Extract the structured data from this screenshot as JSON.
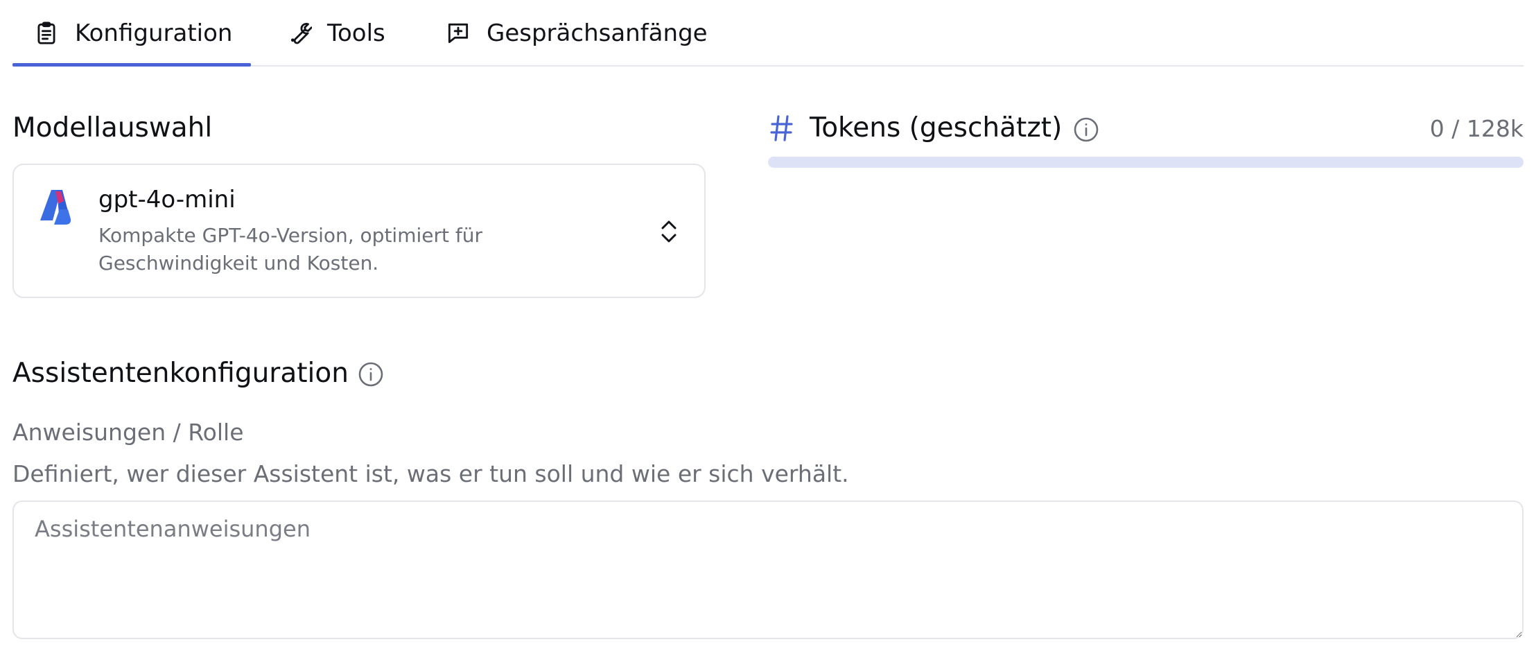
{
  "tabs": [
    {
      "label": "Konfiguration",
      "icon": "clipboard-icon",
      "active": true
    },
    {
      "label": "Tools",
      "icon": "wrench-icon",
      "active": false
    },
    {
      "label": "Gesprächsanfänge",
      "icon": "message-plus-icon",
      "active": false
    }
  ],
  "model_section": {
    "title": "Modellauswahl",
    "selected_model": {
      "name": "gpt-4o-mini",
      "description": "Kompakte GPT-4o-Version, optimiert für Geschwindigkeit und Kosten.",
      "icon": "azure-logo-icon"
    }
  },
  "tokens": {
    "title": "Tokens (geschätzt)",
    "count": "0 / 128k",
    "fill_fraction": 0,
    "icon": "hash-icon"
  },
  "assistant_config": {
    "title": "Assistentenkonfiguration",
    "instructions_label": "Anweisungen / Rolle",
    "instructions_help": "Definiert, wer dieser Assistent ist, was er tun soll und wie er sich verhält.",
    "instructions_placeholder": "Assistentenanweisungen",
    "instructions_value": ""
  },
  "colors": {
    "accent": "#4a63d6",
    "bar_track": "#dde2f7",
    "muted_text": "#6b6e76",
    "border": "#e3e5ea"
  }
}
